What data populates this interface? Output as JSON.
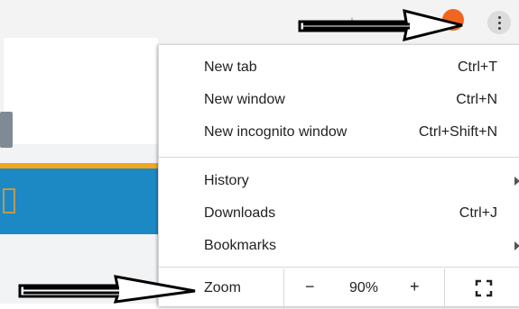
{
  "menu": {
    "items": [
      {
        "label": "New tab",
        "shortcut": "Ctrl+T"
      },
      {
        "label": "New window",
        "shortcut": "Ctrl+N"
      },
      {
        "label": "New incognito window",
        "shortcut": "Ctrl+Shift+N"
      },
      {
        "label": "History",
        "shortcut": ""
      },
      {
        "label": "Downloads",
        "shortcut": "Ctrl+J"
      },
      {
        "label": "Bookmarks",
        "shortcut": ""
      }
    ],
    "zoom": {
      "label": "Zoom",
      "minus": "−",
      "value": "90%",
      "plus": "+"
    }
  },
  "colors": {
    "accent_orange": "#f4a61b",
    "page_blue": "#1d89c4",
    "profile_orange": "#f0651f"
  },
  "icons": [
    "star-icon",
    "profile-icon",
    "more-menu-icon",
    "fullscreen-icon",
    "submenu-arrow-icon",
    "arrow-annotation-icon"
  ]
}
